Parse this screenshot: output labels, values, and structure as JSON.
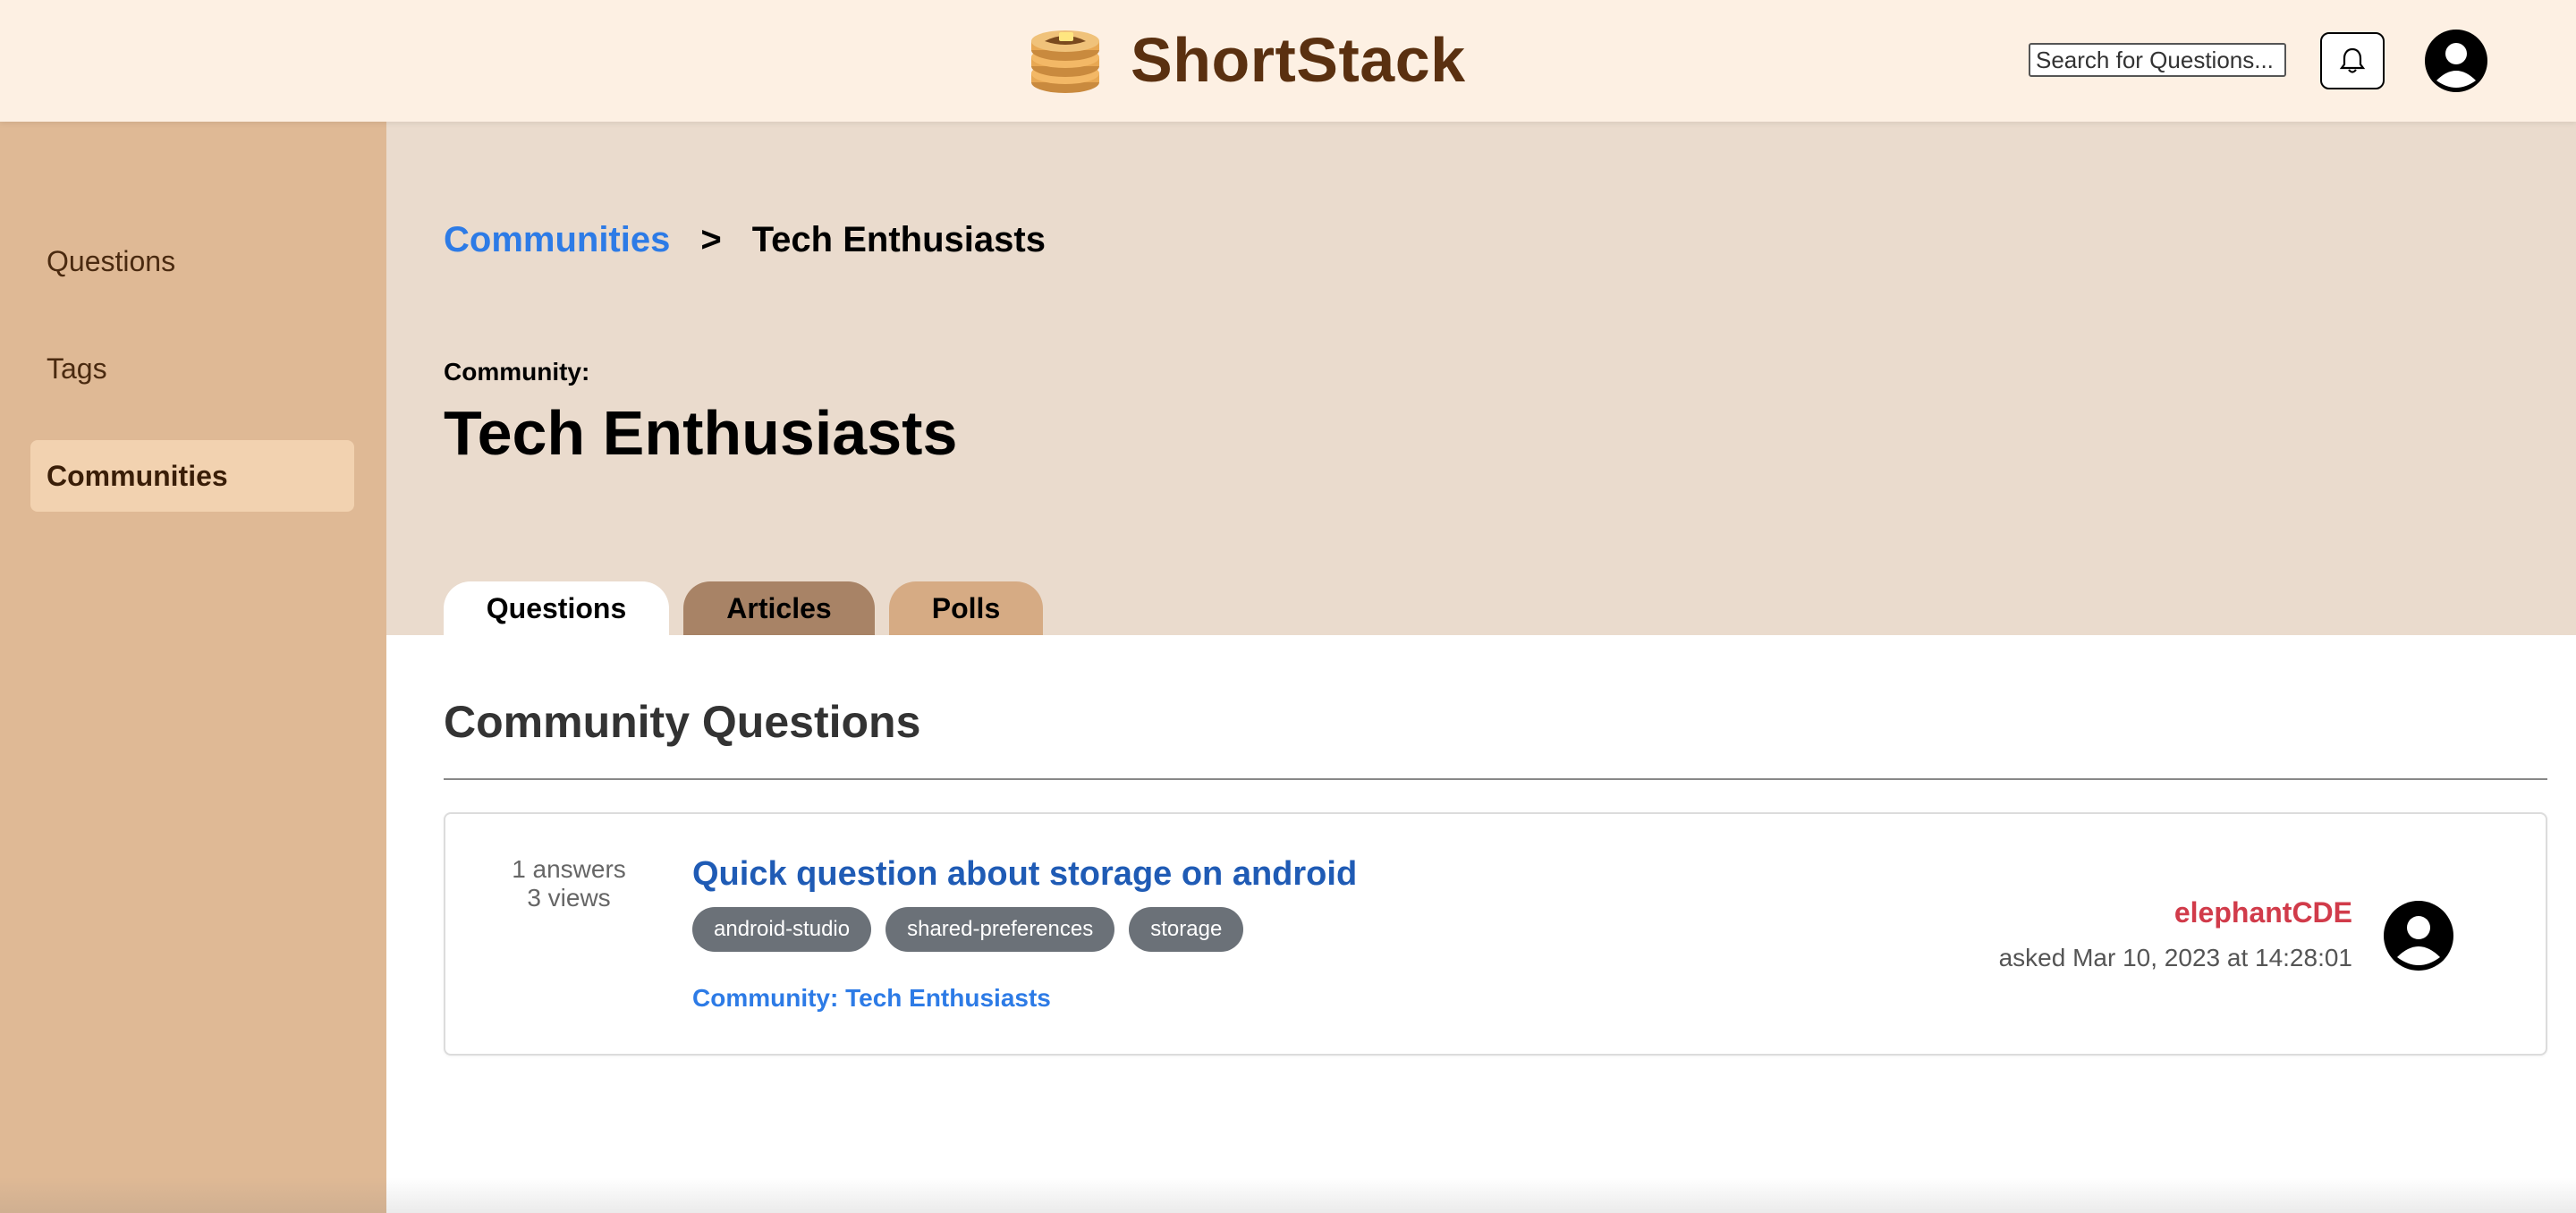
{
  "header": {
    "brand_name": "ShortStack",
    "search_placeholder": "Search for Questions...",
    "icons": {
      "logo": "pancake-stack-icon",
      "notification": "bell-icon",
      "profile": "user-avatar-icon"
    }
  },
  "sidebar": {
    "items": [
      {
        "label": "Questions",
        "active": false
      },
      {
        "label": "Tags",
        "active": false
      },
      {
        "label": "Communities",
        "active": true
      }
    ]
  },
  "breadcrumb": {
    "parent": "Communities",
    "separator": ">",
    "current": "Tech Enthusiasts"
  },
  "community": {
    "label": "Community:",
    "name": "Tech Enthusiasts"
  },
  "tabs": [
    {
      "label": "Questions",
      "active": true
    },
    {
      "label": "Articles",
      "active": false
    },
    {
      "label": "Polls",
      "active": false
    }
  ],
  "section": {
    "title": "Community Questions"
  },
  "questions": [
    {
      "answers": "1 answers",
      "views": "3 views",
      "title": "Quick question about storage on android",
      "tags": [
        "android-studio",
        "shared-preferences",
        "storage"
      ],
      "community": "Community: Tech Enthusiasts",
      "author": "elephantCDE",
      "asked": "asked Mar 10, 2023 at 14:28:01"
    }
  ],
  "colors": {
    "header_bg": "#fdf0e3",
    "sidebar_bg": "#dfb995",
    "sidebar_active": "#f2d2b0",
    "main_top_bg": "#eadbcd",
    "brand_text": "#5a3010",
    "link_blue": "#2d7be6",
    "title_blue": "#1f5bb5",
    "author_red": "#d13b4a",
    "tag_bg": "#6b7178",
    "tab_articles": "#a88366",
    "tab_polls": "#d6ab84"
  }
}
